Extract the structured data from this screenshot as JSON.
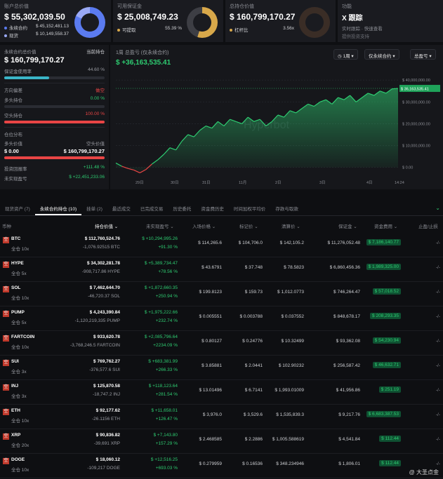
{
  "cards": [
    {
      "label": "账户总价值",
      "value": "$ 55,302,039.50",
      "rows": [
        {
          "name": "永续合约",
          "value": "$ 45,152,481.13",
          "color": "#5b7bf0"
        },
        {
          "name": "现货",
          "value": "$ 10,149,558.37",
          "color": "#9aa9f5"
        }
      ],
      "donut": {
        "color": "#5b7bf0",
        "percent": 82
      }
    },
    {
      "label": "可用保证金",
      "value": "$ 25,008,749.23",
      "rows": [
        {
          "name": "可提取",
          "value": "55.39 %",
          "color": "#d8a84a"
        }
      ],
      "donut": {
        "color": "#d8a84a",
        "percent": 55
      }
    },
    {
      "label": "总持仓价值",
      "value": "$ 160,799,170.27",
      "rows": [
        {
          "name": "杠杆比",
          "value": "3.56x",
          "color": "#d8a84a"
        }
      ],
      "donut": {
        "color": "#3a2d26",
        "percent": 0
      }
    },
    {
      "label": "功能",
      "value": "X 跟踪",
      "rows": [
        {
          "name": "实时跟踪 · 快速查看",
          "value": "",
          "color": ""
        },
        {
          "name": "提供投资支持",
          "value": "",
          "color": ""
        }
      ],
      "donut": null
    }
  ],
  "left_panel": {
    "title": "永续合约总价值",
    "badge": "当前持仓",
    "value": "$ 160,799,170.27",
    "margin_label": "保证金使用率",
    "margin_pct": "44.60 %",
    "margin_fill": 0.446,
    "direction_label": "方向偏差",
    "direction_value": "做空",
    "long_label": "多头持仓",
    "long_pct": "0.00 %",
    "short_label": "空头持仓",
    "short_pct": "100.00 %",
    "dist_label": "仓位分布",
    "long_val_label": "多头价值",
    "short_val_label": "空头价值",
    "long_val": "$ 0.00",
    "short_val": "$ 160,799,170.27",
    "roe_label": "投资回报率",
    "roe": "+111.48 %",
    "upnl_label": "未实现盈亏",
    "upnl": "$ +22,451,233.06"
  },
  "chart": {
    "header": "1周 总盈亏 (仅永续合约)",
    "value": "$ +36,163,535.41",
    "period": "1周",
    "scope": "仅永续合约",
    "metric": "总盈亏",
    "current_tag": "$ 36,163,535.41",
    "watermark": "Hyperbot"
  },
  "chart_data": {
    "type": "area",
    "x_ticks": [
      "29日",
      "30日",
      "31日",
      "11月",
      "2日",
      "3日",
      "4日",
      "14:24"
    ],
    "y_ticks": [
      "$ 40,000,000.00",
      "$ 30,000,000.00",
      "$ 20,000,000.00",
      "$ 10,000,000.00",
      "$ 0.00"
    ],
    "ylim": [
      -3000000,
      42000000
    ],
    "values": [
      2,
      0.5,
      -0.5,
      -1.2,
      -2.5,
      -1,
      1.5,
      3.5,
      6,
      9,
      8,
      12,
      15,
      14,
      17,
      19,
      18,
      21,
      19,
      22,
      21,
      20,
      23,
      21,
      22,
      19,
      21,
      24,
      23,
      26,
      25,
      27,
      29,
      28,
      30,
      31,
      29,
      32,
      31,
      33,
      30,
      32,
      34,
      33,
      35,
      34,
      36,
      36.2
    ],
    "grid": true
  },
  "tabs": [
    "现货资产 (7)",
    "永续合约持仓 (10)",
    "挂单 (2)",
    "最近成交",
    "已完成交易",
    "历史委托",
    "资金费历史",
    "时间加权平均价",
    "存款与取款"
  ],
  "columns": [
    "币种",
    "持仓价值",
    "未实现盈亏",
    "入场价格",
    "标记价",
    "清算价",
    "保证金",
    "资金费用",
    "止盈/止损"
  ],
  "positions": [
    {
      "tag": "空",
      "symbol": "BTC",
      "lev": "全仓 10x",
      "value": "$ 112,760,524.76",
      "size": "-1,076.92515 BTC",
      "pnl": "$ +10,294,995.26",
      "roe": "+91.30 %",
      "entry": "$ 114,265.6",
      "mark": "$ 104,706.0",
      "liq": "$ 142,105.2",
      "margin": "$ 11,276,052.48",
      "funding": "$ 7,186,140.77",
      "tpsl": "-/-"
    },
    {
      "tag": "空",
      "symbol": "HYPE",
      "lev": "全仓 5x",
      "value": "$ 34,302,281.78",
      "size": "-908,717.86 HYPE",
      "pnl": "$ +5,389,734.47",
      "roe": "+78.56 %",
      "entry": "$ 43.6791",
      "mark": "$ 37.748",
      "liq": "$ 78.5823",
      "margin": "$ 6,860,456.36",
      "funding": "$ 1,989,325.00",
      "tpsl": "-/-"
    },
    {
      "tag": "空",
      "symbol": "SOL",
      "lev": "全仓 10x",
      "value": "$ 7,462,644.70",
      "size": "-46,720.37 SOL",
      "pnl": "$ +1,872,660.35",
      "roe": "+250.94 %",
      "entry": "$ 199.8123",
      "mark": "$ 159.73",
      "liq": "$ 1,012.0773",
      "margin": "$ 746,264.47",
      "funding": "$ 57,018.52",
      "tpsl": "-/-"
    },
    {
      "tag": "空",
      "symbol": "PUMP",
      "lev": "全仓 5x",
      "value": "$ 4,243,390.84",
      "size": "-1,120,219,335 PUMP",
      "pnl": "$ +1,975,222.66",
      "roe": "+232.74 %",
      "entry": "$ 0.005551",
      "mark": "$ 0.003788",
      "liq": "$ 0.037552",
      "margin": "$ 848,678.17",
      "funding": "$ 208,293.35",
      "tpsl": "-/-"
    },
    {
      "tag": "空",
      "symbol": "FARTCOIN",
      "lev": "全仓 10x",
      "value": "$ 933,620.78",
      "size": "-3,768,246.5 FARTCOIN",
      "pnl": "$ +2,085,796.64",
      "roe": "+2234.09 %",
      "entry": "$ 0.80127",
      "mark": "$ 0.24776",
      "liq": "$ 10.32499",
      "margin": "$ 93,362.08",
      "funding": "$ 54,230.94",
      "tpsl": "-/-"
    },
    {
      "tag": "空",
      "symbol": "SUI",
      "lev": "全仓 3x",
      "value": "$ 769,762.27",
      "size": "-376,577.6 SUI",
      "pnl": "$ +683,381.99",
      "roe": "+266.33 %",
      "entry": "$ 3.85881",
      "mark": "$ 2.0441",
      "liq": "$ 102.90232",
      "margin": "$ 256,587.42",
      "funding": "$ 46,632.71",
      "tpsl": "-/-"
    },
    {
      "tag": "空",
      "symbol": "INJ",
      "lev": "全仓 3x",
      "value": "$ 125,870.58",
      "size": "-18,747.2 INJ",
      "pnl": "$ +118,123.64",
      "roe": "+281.54 %",
      "entry": "$ 13.01496",
      "mark": "$ 6.7141",
      "liq": "$ 1,993.01009",
      "margin": "$ 41,956.86",
      "funding": "$ 251.19",
      "tpsl": "-/-"
    },
    {
      "tag": "空",
      "symbol": "ETH",
      "lev": "全仓 10x",
      "value": "$ 92,177.62",
      "size": "-26.1156 ETH",
      "pnl": "$ +11,658.01",
      "roe": "+126.47 %",
      "entry": "$ 3,976.0",
      "mark": "$ 3,529.6",
      "liq": "$ 1,535,839.3",
      "margin": "$ 9,217.76",
      "funding": "$ 6,683,387.53",
      "tpsl": "-/-"
    },
    {
      "tag": "空",
      "symbol": "XRP",
      "lev": "全仓 20x",
      "value": "$ 90,836.82",
      "size": "-39,691 XRP",
      "pnl": "$ +7,143.80",
      "roe": "+157.29 %",
      "entry": "$ 2.468585",
      "mark": "$ 2.2886",
      "liq": "$ 1,005.588619",
      "margin": "$ 4,541.84",
      "funding": "$ 112.44",
      "tpsl": "-/-"
    },
    {
      "tag": "空",
      "symbol": "DOGE",
      "lev": "全仓 10x",
      "value": "$ 18,060.12",
      "size": "-109,217 DOGE",
      "pnl": "$ +12,516.25",
      "roe": "+693.03 %",
      "entry": "$ 0.279959",
      "mark": "$ 0.16536",
      "liq": "$ 348.234946",
      "margin": "$ 1,806.01",
      "funding": "$ 112.44",
      "tpsl": "-/-"
    }
  ],
  "footer_watermark": "@ 大圣点金"
}
